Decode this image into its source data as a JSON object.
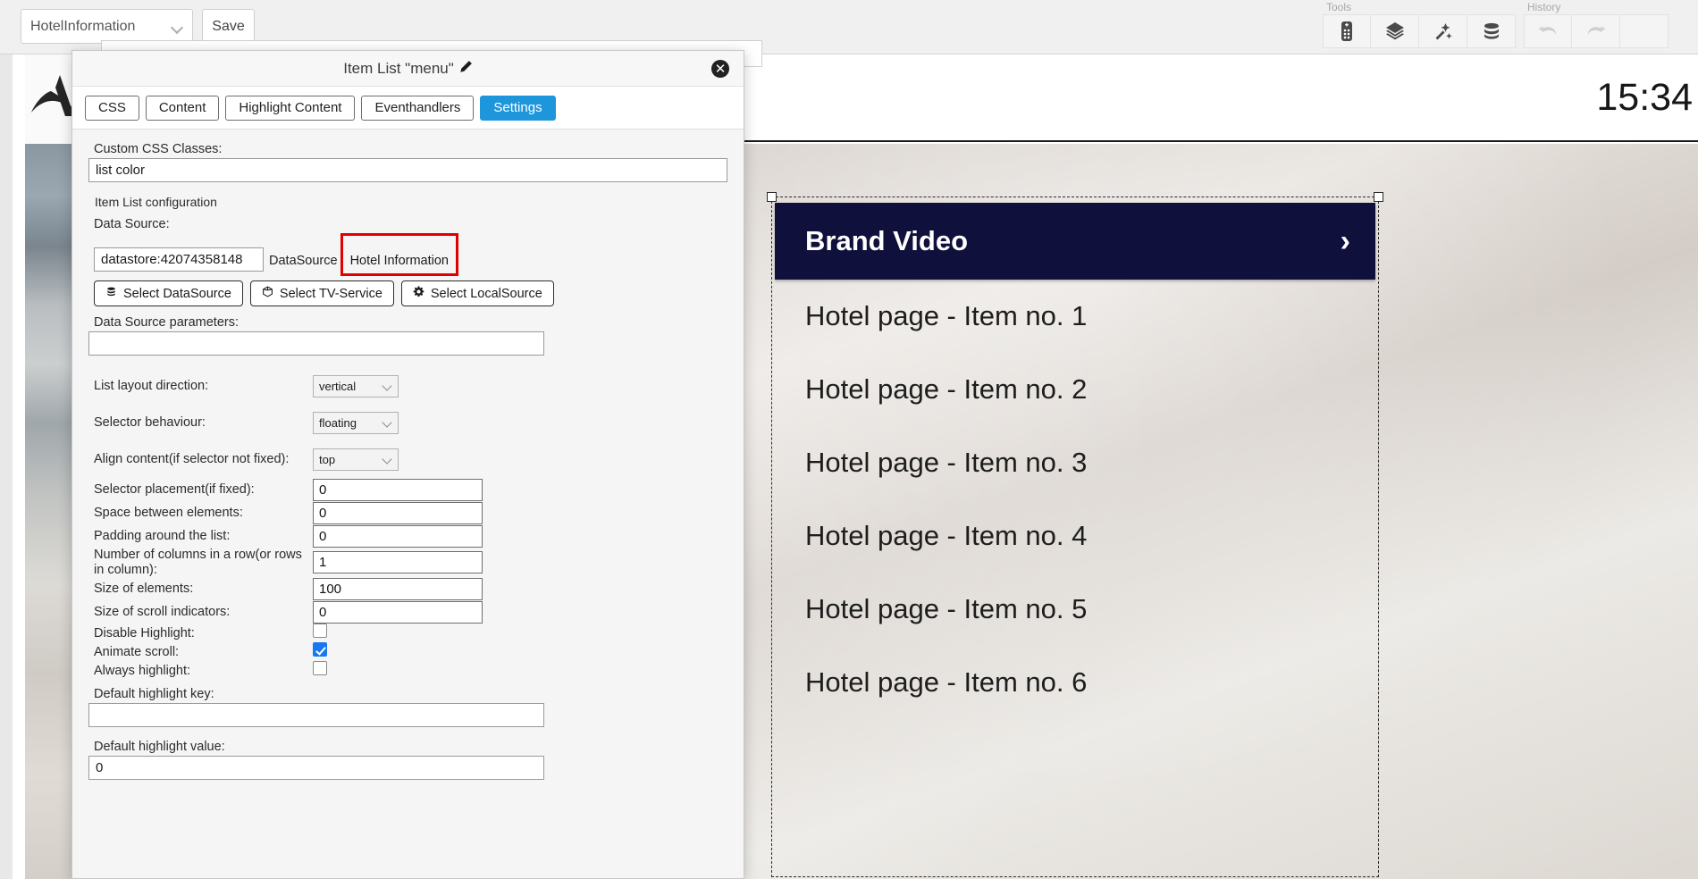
{
  "topbar": {
    "page_select_value": "HotelInformation",
    "save_label": "Save",
    "tools_label": "Tools",
    "history_label": "History",
    "tool_buttons": [
      {
        "name": "remote-control-icon"
      },
      {
        "name": "layers-icon"
      },
      {
        "name": "magic-wand-icon"
      },
      {
        "name": "database-icon"
      }
    ],
    "history_buttons": [
      {
        "name": "undo-icon"
      },
      {
        "name": "redo-icon"
      }
    ]
  },
  "preview": {
    "clock": "15:34",
    "menu_items": [
      {
        "label": "Brand Video",
        "active": true,
        "arrow": "›"
      },
      {
        "label": "Hotel page - Item no. 1",
        "active": false
      },
      {
        "label": "Hotel page - Item no. 2",
        "active": false
      },
      {
        "label": "Hotel page - Item no. 3",
        "active": false
      },
      {
        "label": "Hotel page - Item no. 4",
        "active": false
      },
      {
        "label": "Hotel page - Item no. 5",
        "active": false
      },
      {
        "label": "Hotel page - Item no. 6",
        "active": false
      }
    ],
    "accent_color": "#10103c"
  },
  "dialog": {
    "title": "Item List \"menu\"",
    "close_label": "✕",
    "tabs": [
      {
        "label": "CSS",
        "active": false
      },
      {
        "label": "Content",
        "active": false
      },
      {
        "label": "Highlight Content",
        "active": false
      },
      {
        "label": "Eventhandlers",
        "active": false
      },
      {
        "label": "Settings",
        "active": true
      }
    ],
    "active_tab_color": "#1e96db",
    "form": {
      "custom_css_label": "Custom CSS Classes:",
      "custom_css_value": "list color",
      "section_title": "Item List configuration",
      "data_source_label": "Data Source:",
      "data_source_value": "datastore:42074358148",
      "data_source_kind": "DataSource",
      "data_source_name": "Hotel Information",
      "highlight_color": "#e00000",
      "buttons": [
        {
          "label": "Select DataSource",
          "icon": "database-icon"
        },
        {
          "label": "Select TV-Service",
          "icon": "cube-icon"
        },
        {
          "label": "Select LocalSource",
          "icon": "gear-icon"
        }
      ],
      "params_label": "Data Source parameters:",
      "params_value": "",
      "rows": [
        {
          "label": "List layout direction:",
          "type": "select",
          "value": "vertical"
        },
        {
          "label": "Selector behaviour:",
          "type": "select",
          "value": "floating"
        },
        {
          "label": "Align content(if selector not fixed):",
          "type": "select",
          "value": "top"
        },
        {
          "label": "Selector placement(if fixed):",
          "type": "number",
          "value": "0"
        },
        {
          "label": "Space between elements:",
          "type": "number",
          "value": "0"
        },
        {
          "label": "Padding around the list:",
          "type": "number",
          "value": "0"
        },
        {
          "label": "Number of columns in a row(or rows in column):",
          "type": "number",
          "value": "1"
        },
        {
          "label": "Size of elements:",
          "type": "number",
          "value": "100"
        },
        {
          "label": "Size of scroll indicators:",
          "type": "number",
          "value": "0"
        },
        {
          "label": "Disable Highlight:",
          "type": "checkbox",
          "checked": false
        },
        {
          "label": "Animate scroll:",
          "type": "checkbox",
          "checked": true
        },
        {
          "label": "Always highlight:",
          "type": "checkbox",
          "checked": false
        }
      ],
      "highlight_key_label": "Default highlight key:",
      "highlight_key_value": "",
      "highlight_value_label": "Default highlight value:",
      "highlight_value_value": "0"
    }
  }
}
